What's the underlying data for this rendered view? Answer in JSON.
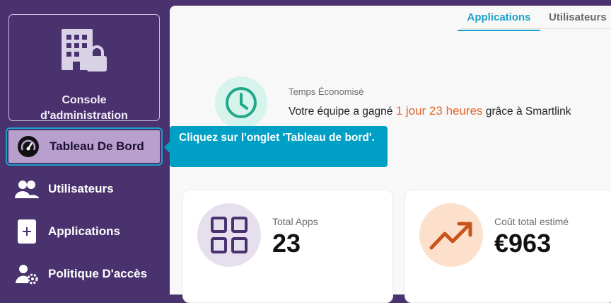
{
  "sidebar": {
    "console": {
      "line1": "Console",
      "line2": "d'administration",
      "icon": "building-lock-icon"
    },
    "items": [
      {
        "label": "Tableau De Bord",
        "icon": "gauge-icon",
        "active": true
      },
      {
        "label": "Utilisateurs",
        "icon": "users-icon"
      },
      {
        "label": "Applications",
        "icon": "add-app-icon"
      },
      {
        "label": "Politique D'accès",
        "icon": "user-gear-icon"
      }
    ]
  },
  "tabs": [
    {
      "label": "Applications",
      "active": true
    },
    {
      "label": "Utilisateurs",
      "active": false
    }
  ],
  "time_saved": {
    "label": "Temps Économisé",
    "text_before": "Votre équipe a gagné ",
    "highlight": "1 jour 23 heures",
    "text_after": " grâce à Smartlink",
    "icon": "clock-icon"
  },
  "cards": {
    "apps": {
      "label": "Total Apps",
      "value": "23",
      "icon": "grid-icon"
    },
    "cost": {
      "label": "Coût total estimé",
      "value": "€963",
      "icon": "trend-up-icon"
    }
  },
  "tooltip": {
    "text": "Cliquez sur l'onglet 'Tableau de bord'."
  },
  "colors": {
    "sidebar": "#4a326f",
    "accent": "#1aa0c8",
    "tooltip": "#00a0c6",
    "highlight": "#e0662a"
  }
}
